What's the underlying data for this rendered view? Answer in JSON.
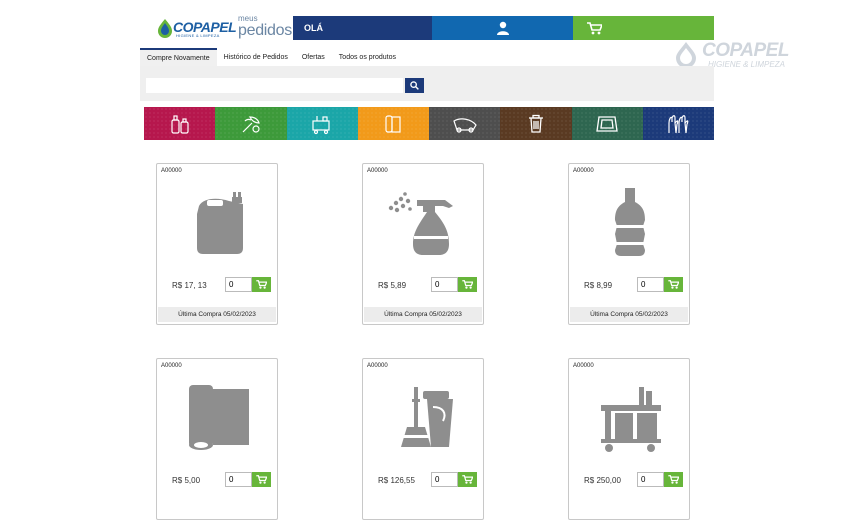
{
  "brand": {
    "logo_name": "COPAPEL",
    "logo_sub": "HIGIENE & LIMPEZA",
    "app_small": "meus",
    "app_big": "pedidos"
  },
  "header": {
    "greeting": "OLÁ",
    "colors": {
      "greeting_bg": "#1c3a7a",
      "user_bg": "#1168b0",
      "cart_bg": "#67b53a"
    }
  },
  "watermark": {
    "name": "COPAPEL",
    "sub": "HIGIENE & LIMPEZA"
  },
  "tabs": [
    {
      "label": "Compre Novamente",
      "active": true
    },
    {
      "label": "Histórico de Pedidos",
      "active": false
    },
    {
      "label": "Ofertas",
      "active": false
    },
    {
      "label": "Todos os produtos",
      "active": false
    }
  ],
  "search": {
    "placeholder": "",
    "value": ""
  },
  "categories": [
    {
      "icon": "bottles-icon",
      "color": "#b6174d"
    },
    {
      "icon": "garden-icon",
      "color": "#3d9a3a"
    },
    {
      "icon": "cleaning-cart-icon",
      "color": "#1ba6a8"
    },
    {
      "icon": "paper-roll-icon",
      "color": "#f29a1a"
    },
    {
      "icon": "floor-machine-icon",
      "color": "#4e4e4e"
    },
    {
      "icon": "trash-bin-icon",
      "color": "#5a3a22"
    },
    {
      "icon": "tray-icon",
      "color": "#2e6650"
    },
    {
      "icon": "gloves-icon",
      "color": "#1c3a7a"
    }
  ],
  "products": [
    {
      "code": "A00000",
      "price": "R$ 17, 13",
      "qty": "0",
      "last_purchase": "Última Compra 05/02/2023",
      "icon": "jerrycan-icon"
    },
    {
      "code": "A00000",
      "price": "R$ 5,89",
      "qty": "0",
      "last_purchase": "Última Compra 05/02/2023",
      "icon": "spray-bottle-icon"
    },
    {
      "code": "A00000",
      "price": "R$ 8,99",
      "qty": "0",
      "last_purchase": "Última Compra 05/02/2023",
      "icon": "detergent-bottle-icon"
    },
    {
      "code": "A00000",
      "price": "R$ 5,00",
      "qty": "0",
      "last_purchase": "",
      "icon": "paper-towel-icon"
    },
    {
      "code": "A00000",
      "price": "R$ 126,55",
      "qty": "0",
      "last_purchase": "",
      "icon": "mop-bucket-icon"
    },
    {
      "code": "A00000",
      "price": "R$ 250,00",
      "qty": "0",
      "last_purchase": "",
      "icon": "janitor-cart-icon"
    }
  ]
}
